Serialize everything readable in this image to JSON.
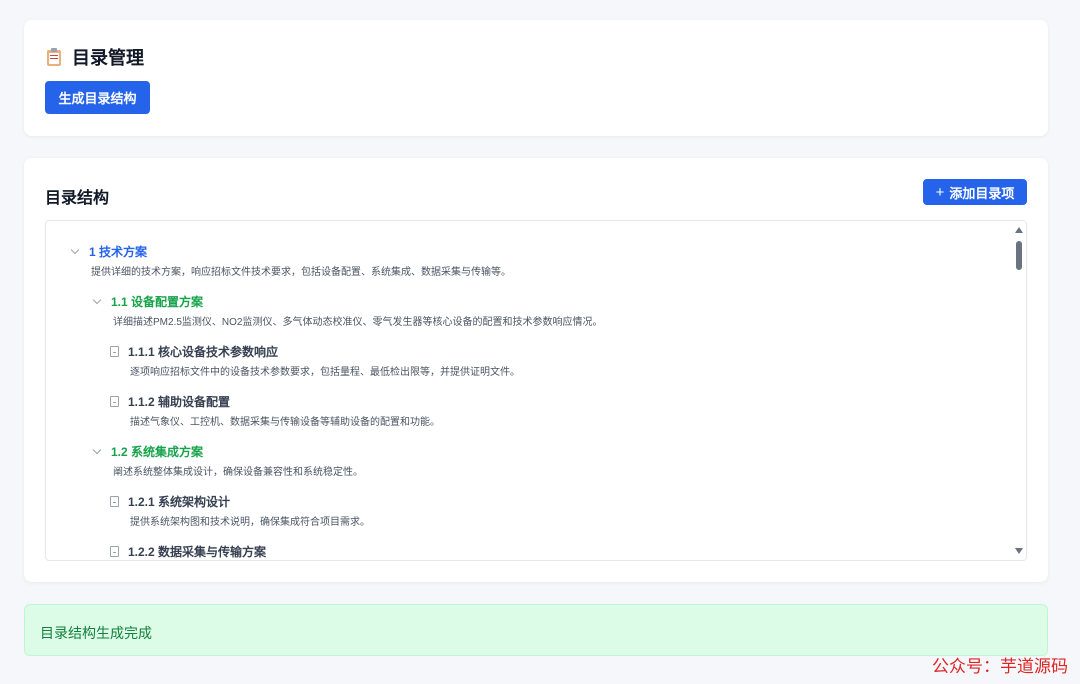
{
  "header": {
    "title": "目录管理",
    "title_icon": "clipboard-icon",
    "generate_button": "生成目录结构"
  },
  "tree_section": {
    "title": "目录结构",
    "add_button": "添加目录项",
    "add_icon": "plus-icon"
  },
  "tree": [
    {
      "level": 1,
      "label": "1 技术方案",
      "desc": "提供详细的技术方案，响应招标文件技术要求，包括设备配置、系统集成、数据采集与传输等。",
      "expanded": true
    },
    {
      "level": 2,
      "label": "1.1 设备配置方案",
      "desc": "详细描述PM2.5监测仪、NO2监测仪、多气体动态校准仪、零气发生器等核心设备的配置和技术参数响应情况。",
      "expanded": true
    },
    {
      "level": 3,
      "label": "1.1.1 核心设备技术参数响应",
      "desc": "逐项响应招标文件中的设备技术参数要求，包括量程、最低检出限等，并提供证明文件。"
    },
    {
      "level": 3,
      "label": "1.1.2 辅助设备配置",
      "desc": "描述气象仪、工控机、数据采集与传输设备等辅助设备的配置和功能。"
    },
    {
      "level": 2,
      "label": "1.2 系统集成方案",
      "desc": "阐述系统整体集成设计，确保设备兼容性和系统稳定性。",
      "expanded": true
    },
    {
      "level": 3,
      "label": "1.2.1 系统架构设计",
      "desc": "提供系统架构图和技术说明，确保集成符合项目需求。"
    },
    {
      "level": 3,
      "label": "1.2.2 数据采集与传输方案",
      "desc": ""
    }
  ],
  "status": {
    "message": "目录结构生成完成"
  },
  "watermark": "公众号：芋道源码",
  "colors": {
    "primary": "#2563eb",
    "level1": "#2563eb",
    "level2": "#16a34a",
    "success_bg": "#dcfce7",
    "success_text": "#15803d",
    "watermark": "#dc2626"
  }
}
